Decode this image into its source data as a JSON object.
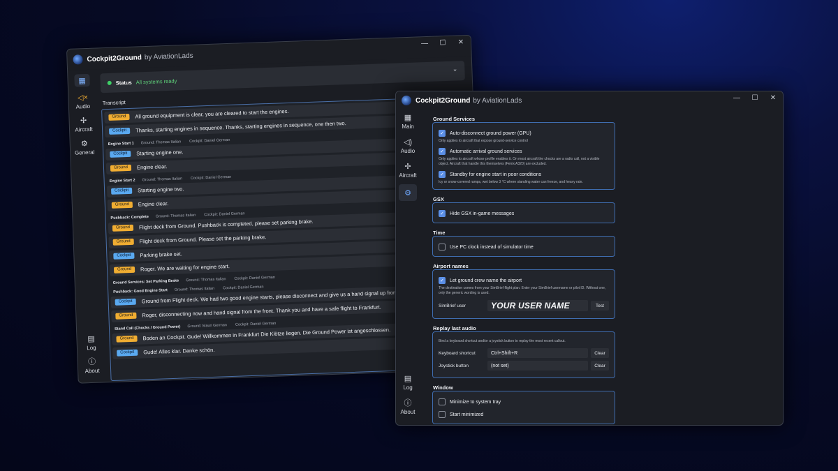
{
  "win1": {
    "app_title": "Cockpit2Ground",
    "app_by": "by AviationLads",
    "rail": [
      {
        "label": "",
        "icon": "dashboard-icon"
      },
      {
        "label": "Audio",
        "icon": "speaker-icon"
      },
      {
        "label": "Aircraft",
        "icon": "aircraft-icon"
      },
      {
        "label": "General",
        "icon": "gear-icon"
      }
    ],
    "rail_bottom": [
      {
        "label": "Log",
        "icon": "log-icon"
      },
      {
        "label": "About",
        "icon": "info-icon"
      }
    ],
    "status": {
      "label": "Status",
      "text": "All systems ready"
    },
    "transcript_label": "Transcript",
    "transcript": [
      {
        "type": "msg",
        "role": "Ground",
        "text": "All ground equipment is clear, you are cleared to start the engines."
      },
      {
        "type": "msg",
        "role": "Cockpit",
        "text": "Thanks, starting engines in sequence. Thanks, starting engines in sequence, one then two."
      },
      {
        "type": "sec",
        "title": "Engine Start 1",
        "ground": "Ground: Thomas Italian",
        "cockpit": "Cockpit: Daniel German"
      },
      {
        "type": "msg",
        "role": "Cockpit",
        "text": "Starting engine one."
      },
      {
        "type": "msg",
        "role": "Ground",
        "text": "Engine clear."
      },
      {
        "type": "sec",
        "title": "Engine Start 2",
        "ground": "Ground: Thomas Italian",
        "cockpit": "Cockpit: Daniel German"
      },
      {
        "type": "msg",
        "role": "Cockpit",
        "text": "Starting engine two."
      },
      {
        "type": "msg",
        "role": "Ground",
        "text": "Engine clear."
      },
      {
        "type": "sec",
        "title": "Pushback: Complete",
        "ground": "Ground: Thomas Italian",
        "cockpit": "Cockpit: Daniel German"
      },
      {
        "type": "msg",
        "role": "Ground",
        "text": "Flight deck from Ground. Pushback is completed, please set parking brake."
      },
      {
        "type": "msg",
        "role": "Ground",
        "text": "Flight deck from Ground. Please set the parking brake."
      },
      {
        "type": "msg",
        "role": "Cockpit",
        "text": "Parking brake set."
      },
      {
        "type": "msg",
        "role": "Ground",
        "text": "Roger. We are waiting for engine start."
      },
      {
        "type": "sec",
        "title": "Ground Services: Set Parking Brake",
        "ground": "Ground: Thomas Italian",
        "cockpit": "Cockpit: Daniel German"
      },
      {
        "type": "sec",
        "title": "Pushback: Good Engine Start",
        "ground": "Ground: Thomas Italian",
        "cockpit": "Cockpit: Daniel German"
      },
      {
        "type": "msg",
        "role": "Cockpit",
        "text": "Ground from Flight deck. We had two good engine starts, please disconnect and give us a hand signal up front."
      },
      {
        "type": "msg",
        "role": "Ground",
        "text": "Roger, disconnecting now and hand signal from the front. Thank you and have a safe flight to Frankfurt."
      },
      {
        "type": "sec",
        "title": "Stand Call (Chocks / Ground Power)",
        "ground": "Ground: Mauri German",
        "cockpit": "Cockpit: Daniel German"
      },
      {
        "type": "msg",
        "role": "Ground",
        "text": "Boden an Cockpit. Gude! Willkommen in Frankfurt Die Klötze liegen. Die Ground Power ist angeschlossen."
      },
      {
        "type": "msg",
        "role": "Cockpit",
        "text": "Gude! Alles klar. Danke schön."
      }
    ]
  },
  "win2": {
    "app_title": "Cockpit2Ground",
    "app_by": "by AviationLads",
    "rail": [
      {
        "label": "Main",
        "icon": "dashboard-icon"
      },
      {
        "label": "Audio",
        "icon": "speaker-icon"
      },
      {
        "label": "Aircraft",
        "icon": "aircraft-icon"
      },
      {
        "label": "",
        "icon": "gear-icon"
      }
    ],
    "rail_bottom": [
      {
        "label": "Log",
        "icon": "log-icon"
      },
      {
        "label": "About",
        "icon": "info-icon"
      }
    ],
    "ground_services": {
      "title": "Ground Services",
      "gpu_label": "Auto-disconnect ground power (GPU)",
      "gpu_help": "Only applies to aircraft that expose ground-service control",
      "arrival_label": "Automatic arrival ground services",
      "arrival_help": "Only applies to aircraft whose profile enables it. On most aircraft the chocks are a radio call, not a visible object. Aircraft that handle this themselves (Fenix A320) are excluded.",
      "standby_label": "Standby for engine start in poor conditions",
      "standby_help": "Icy or snow-covered ramps, wet below 3 °C where standing water can freeze, and heavy rain."
    },
    "gsx": {
      "title": "GSX",
      "label": "Hide GSX in-game messages"
    },
    "time": {
      "title": "Time",
      "label": "Use PC clock instead of simulator time"
    },
    "airport": {
      "title": "Airport names",
      "label": "Let ground crew name the airport",
      "help": "The destination comes from your SimBrief flight plan. Enter your SimBrief username or pilot ID. Without one, only the generic wording is used.",
      "user_label": "SimBrief user",
      "user_value": "YOUR USER NAME",
      "test_label": "Test"
    },
    "replay": {
      "title": "Replay last audio",
      "help": "Bind a keyboard shortcut and/or a joystick button to replay the most recent callout.",
      "kb_label": "Keyboard shortcut",
      "kb_value": "Ctrl+Shift+R",
      "js_label": "Joystick button",
      "js_value": "(not set)",
      "clear_label": "Clear"
    },
    "window": {
      "title": "Window",
      "minimize_label": "Minimize to system tray",
      "start_min_label": "Start minimized"
    }
  },
  "icons": {
    "dashboard-icon": "▦",
    "speaker-icon": "🔈",
    "aircraft-icon": "✢",
    "gear-icon": "⚙",
    "log-icon": "▤",
    "info-icon": "ⓘ"
  }
}
